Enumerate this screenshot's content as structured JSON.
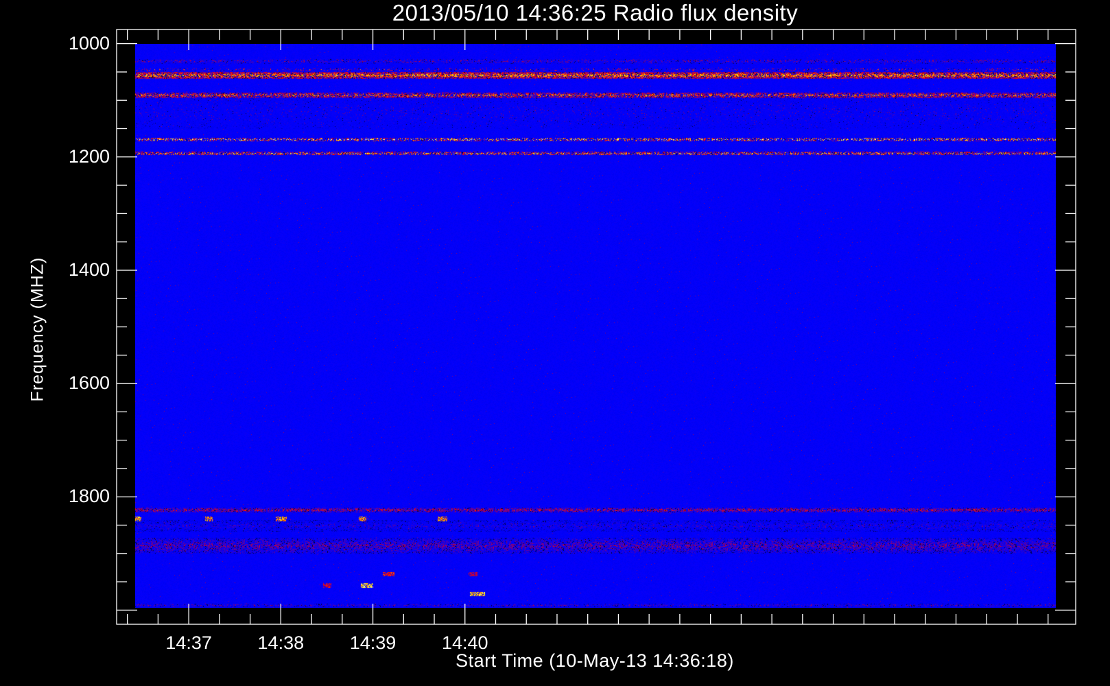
{
  "chart_data": {
    "type": "heatmap",
    "title": "2013/05/10 14:36:25 Radio flux density",
    "xlabel": "Start Time (10-May-13 14:36:18)",
    "ylabel": "Frequency (MHZ)",
    "x_unit": "seconds after 14:36:00",
    "xlim": [
      13,
      638
    ],
    "data_time_range": [
      25,
      625
    ],
    "xticks": [
      {
        "value": 60,
        "label": "14:37"
      },
      {
        "value": 120,
        "label": "14:38"
      },
      {
        "value": 180,
        "label": "14:39"
      },
      {
        "value": 240,
        "label": "14:40"
      }
    ],
    "x_minor_step": 20,
    "ylim": [
      2025,
      975
    ],
    "data_freq_range": [
      1000,
      1995
    ],
    "yticks": [
      {
        "value": 1000,
        "label": "1000"
      },
      {
        "value": 1200,
        "label": "1200"
      },
      {
        "value": 1400,
        "label": "1400"
      },
      {
        "value": 1600,
        "label": "1600"
      },
      {
        "value": 1800,
        "label": "1800"
      }
    ],
    "y_minor_step": 50,
    "colormap": [
      "#000000",
      "#0000ff",
      "#ff0000",
      "#ffff00",
      "#ffffff"
    ],
    "background_level": 0.25,
    "bands": [
      {
        "freq": 1030,
        "width": 4,
        "level": 0.45,
        "density": 0.3
      },
      {
        "freq": 1045,
        "width": 3,
        "level": 0.6,
        "density": 0.15
      },
      {
        "freq": 1055,
        "width": 6,
        "level": 0.75,
        "density": 0.8
      },
      {
        "freq": 1090,
        "width": 5,
        "level": 0.7,
        "density": 0.6
      },
      {
        "freq": 1120,
        "width": 30,
        "level": 0.38,
        "density": 0.08
      },
      {
        "freq": 1168,
        "width": 3,
        "level": 0.9,
        "density": 0.4
      },
      {
        "freq": 1193,
        "width": 3,
        "level": 0.8,
        "density": 0.5
      },
      {
        "freq": 1822,
        "width": 4,
        "level": 0.55,
        "density": 0.6
      },
      {
        "freq": 1850,
        "width": 10,
        "level": 0.35,
        "density": 0.3
      },
      {
        "freq": 1885,
        "width": 14,
        "level": 0.45,
        "density": 0.5
      },
      {
        "freq": 1990,
        "width": 3,
        "level": 0.4,
        "density": 0.4
      }
    ],
    "bursts": [
      {
        "time": 26,
        "freq": 1838,
        "duration": 6,
        "level": 0.85
      },
      {
        "time": 73,
        "freq": 1838,
        "duration": 5,
        "level": 0.8
      },
      {
        "time": 120,
        "freq": 1838,
        "duration": 7,
        "level": 0.8
      },
      {
        "time": 173,
        "freq": 1838,
        "duration": 5,
        "level": 0.8
      },
      {
        "time": 225,
        "freq": 1838,
        "duration": 6,
        "level": 0.8
      },
      {
        "time": 176,
        "freq": 1955,
        "duration": 8,
        "level": 0.95
      },
      {
        "time": 150,
        "freq": 1955,
        "duration": 5,
        "level": 0.6
      },
      {
        "time": 190,
        "freq": 1935,
        "duration": 8,
        "level": 0.65
      },
      {
        "time": 248,
        "freq": 1970,
        "duration": 10,
        "level": 0.9
      },
      {
        "time": 245,
        "freq": 1935,
        "duration": 6,
        "level": 0.55
      }
    ]
  }
}
